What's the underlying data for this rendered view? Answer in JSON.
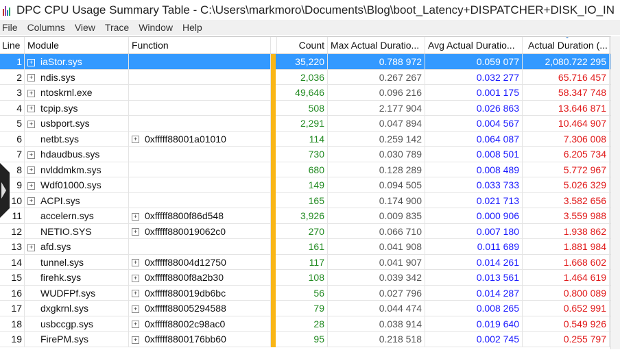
{
  "window": {
    "title": "DPC CPU Usage Summary Table - C:\\Users\\markmoro\\Documents\\Blog\\boot_Latency+DISPATCHER+DISK_IO_IN"
  },
  "menu": [
    "File",
    "Columns",
    "View",
    "Trace",
    "Window",
    "Help"
  ],
  "columns": {
    "line": "Line",
    "module": "Module",
    "function": "Function",
    "count": "Count",
    "max": "Max Actual Duratio...",
    "avg": "Avg Actual Duratio...",
    "actual": "Actual Duration (..."
  },
  "colors": {
    "selection": "#3399ff",
    "count": "#218a21",
    "avg": "#1a1aff",
    "actual": "#e01818",
    "divider": "#f9b617"
  },
  "rows": [
    {
      "line": "1",
      "module": "iaStor.sys",
      "function": "",
      "count": "35,220",
      "max": "0.788 972",
      "avg": "0.059 077",
      "actual": "2,080.722 295",
      "mod_exp": true,
      "fn_exp": false,
      "selected": true
    },
    {
      "line": "2",
      "module": "ndis.sys",
      "function": "",
      "count": "2,036",
      "max": "0.267 267",
      "avg": "0.032 277",
      "actual": "65.716 457",
      "mod_exp": true,
      "fn_exp": false
    },
    {
      "line": "3",
      "module": "ntoskrnl.exe",
      "function": "",
      "count": "49,646",
      "max": "0.096 216",
      "avg": "0.001 175",
      "actual": "58.347 748",
      "mod_exp": true,
      "fn_exp": false
    },
    {
      "line": "4",
      "module": "tcpip.sys",
      "function": "",
      "count": "508",
      "max": "2.177 904",
      "avg": "0.026 863",
      "actual": "13.646 871",
      "mod_exp": true,
      "fn_exp": false
    },
    {
      "line": "5",
      "module": "usbport.sys",
      "function": "",
      "count": "2,291",
      "max": "0.047 894",
      "avg": "0.004 567",
      "actual": "10.464 907",
      "mod_exp": true,
      "fn_exp": false
    },
    {
      "line": "6",
      "module": "netbt.sys",
      "function": "0xfffff88001a01010",
      "count": "114",
      "max": "0.259 142",
      "avg": "0.064 087",
      "actual": "7.306 008",
      "mod_exp": false,
      "fn_exp": true
    },
    {
      "line": "7",
      "module": "hdaudbus.sys",
      "function": "",
      "count": "730",
      "max": "0.030 789",
      "avg": "0.008 501",
      "actual": "6.205 734",
      "mod_exp": true,
      "fn_exp": false
    },
    {
      "line": "8",
      "module": "nvlddmkm.sys",
      "function": "",
      "count": "680",
      "max": "0.128 289",
      "avg": "0.008 489",
      "actual": "5.772 967",
      "mod_exp": true,
      "fn_exp": false
    },
    {
      "line": "9",
      "module": "Wdf01000.sys",
      "function": "",
      "count": "149",
      "max": "0.094 505",
      "avg": "0.033 733",
      "actual": "5.026 329",
      "mod_exp": true,
      "fn_exp": false
    },
    {
      "line": "10",
      "module": "ACPI.sys",
      "function": "",
      "count": "165",
      "max": "0.174 900",
      "avg": "0.021 713",
      "actual": "3.582 656",
      "mod_exp": true,
      "fn_exp": false
    },
    {
      "line": "11",
      "module": "accelern.sys",
      "function": "0xfffff8800f86d548",
      "count": "3,926",
      "max": "0.009 835",
      "avg": "0.000 906",
      "actual": "3.559 988",
      "mod_exp": false,
      "fn_exp": true
    },
    {
      "line": "12",
      "module": "NETIO.SYS",
      "function": "0xfffff880019062c0",
      "count": "270",
      "max": "0.066 710",
      "avg": "0.007 180",
      "actual": "1.938 862",
      "mod_exp": false,
      "fn_exp": true
    },
    {
      "line": "13",
      "module": "afd.sys",
      "function": "",
      "count": "161",
      "max": "0.041 908",
      "avg": "0.011 689",
      "actual": "1.881 984",
      "mod_exp": true,
      "fn_exp": false
    },
    {
      "line": "14",
      "module": "tunnel.sys",
      "function": "0xfffff88004d12750",
      "count": "117",
      "max": "0.041 907",
      "avg": "0.014 261",
      "actual": "1.668 602",
      "mod_exp": false,
      "fn_exp": true
    },
    {
      "line": "15",
      "module": "firehk.sys",
      "function": "0xfffff8800f8a2b30",
      "count": "108",
      "max": "0.039 342",
      "avg": "0.013 561",
      "actual": "1.464 619",
      "mod_exp": false,
      "fn_exp": true
    },
    {
      "line": "16",
      "module": "WUDFPf.sys",
      "function": "0xfffff880019db6bc",
      "count": "56",
      "max": "0.027 796",
      "avg": "0.014 287",
      "actual": "0.800 089",
      "mod_exp": false,
      "fn_exp": true
    },
    {
      "line": "17",
      "module": "dxgkrnl.sys",
      "function": "0xfffff88005294588",
      "count": "79",
      "max": "0.044 474",
      "avg": "0.008 265",
      "actual": "0.652 991",
      "mod_exp": false,
      "fn_exp": true
    },
    {
      "line": "18",
      "module": "usbccgp.sys",
      "function": "0xfffff88002c98ac0",
      "count": "28",
      "max": "0.038 914",
      "avg": "0.019 640",
      "actual": "0.549 926",
      "mod_exp": false,
      "fn_exp": true
    },
    {
      "line": "19",
      "module": "FirePM.sys",
      "function": "0xfffff8800176bb60",
      "count": "95",
      "max": "0.218 518",
      "avg": "0.002 745",
      "actual": "0.255 797",
      "mod_exp": false,
      "fn_exp": true
    }
  ]
}
